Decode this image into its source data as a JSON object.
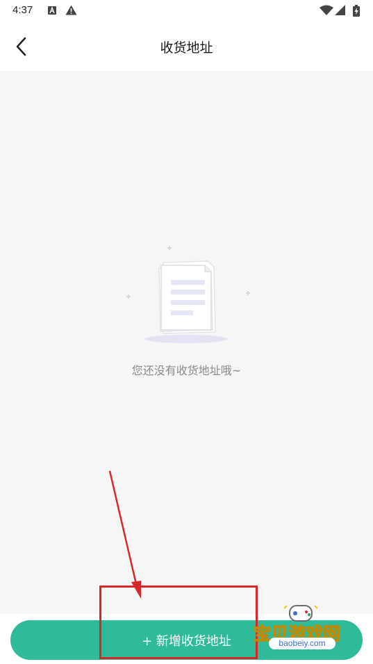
{
  "status_bar": {
    "time": "4:37",
    "left_icons": [
      "a-notification-icon",
      "warning-icon"
    ],
    "right_icons": [
      "wifi-icon",
      "signal-icon",
      "battery-charging-icon"
    ]
  },
  "header": {
    "title": "收货地址",
    "back_icon": "chevron-left-icon"
  },
  "empty_state": {
    "message": "您还没有收货地址哦~",
    "icon": "empty-document-icon"
  },
  "actions": {
    "add_address_label": "+ 新增收货地址"
  },
  "watermark": {
    "title": "宝贝游戏网",
    "url": "baobeiy.com"
  },
  "colors": {
    "primary": "#2fbb9a",
    "background": "#f6f6f6",
    "annotation": "#d9262b"
  }
}
